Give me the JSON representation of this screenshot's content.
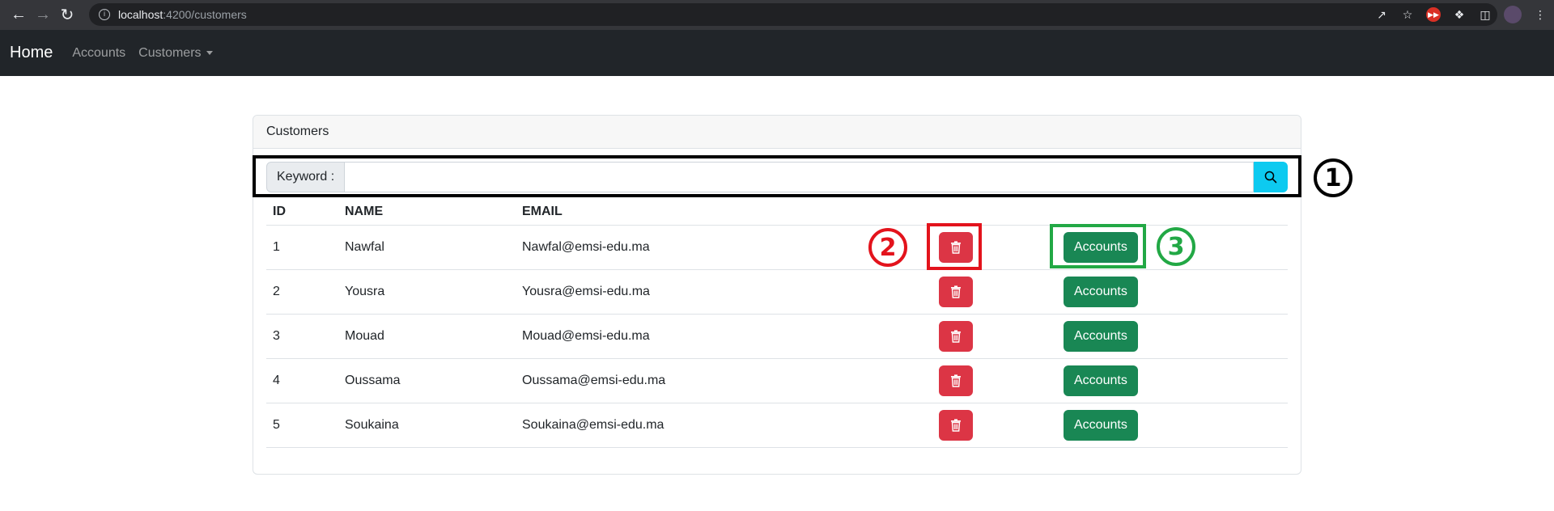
{
  "browser": {
    "url_host": "localhost",
    "url_path": ":4200/customers"
  },
  "navbar": {
    "brand": "Home",
    "links": [
      {
        "label": "Accounts"
      },
      {
        "label": "Customers"
      }
    ]
  },
  "card": {
    "header": "Customers"
  },
  "search": {
    "label": "Keyword :",
    "value": "",
    "placeholder": ""
  },
  "table": {
    "headers": [
      "ID",
      "NAME",
      "EMAIL"
    ],
    "rows": [
      {
        "id": "1",
        "name": "Nawfal",
        "email": "Nawfal@emsi-edu.ma",
        "action": "Accounts"
      },
      {
        "id": "2",
        "name": "Yousra",
        "email": "Yousra@emsi-edu.ma",
        "action": "Accounts"
      },
      {
        "id": "3",
        "name": "Mouad",
        "email": "Mouad@emsi-edu.ma",
        "action": "Accounts"
      },
      {
        "id": "4",
        "name": "Oussama",
        "email": "Oussama@emsi-edu.ma",
        "action": "Accounts"
      },
      {
        "id": "5",
        "name": "Soukaina",
        "email": "Soukaina@emsi-edu.ma",
        "action": "Accounts"
      }
    ]
  },
  "annotations": [
    {
      "label": "1",
      "color": "#000000"
    },
    {
      "label": "2",
      "color": "#e3131c"
    },
    {
      "label": "3",
      "color": "#22a845"
    }
  ],
  "icons": {
    "delete": "trash-icon",
    "search": "search-icon"
  },
  "colors": {
    "danger": "#dc3545",
    "success": "#198754",
    "info": "#0dcaf0",
    "navbar": "#212529"
  }
}
